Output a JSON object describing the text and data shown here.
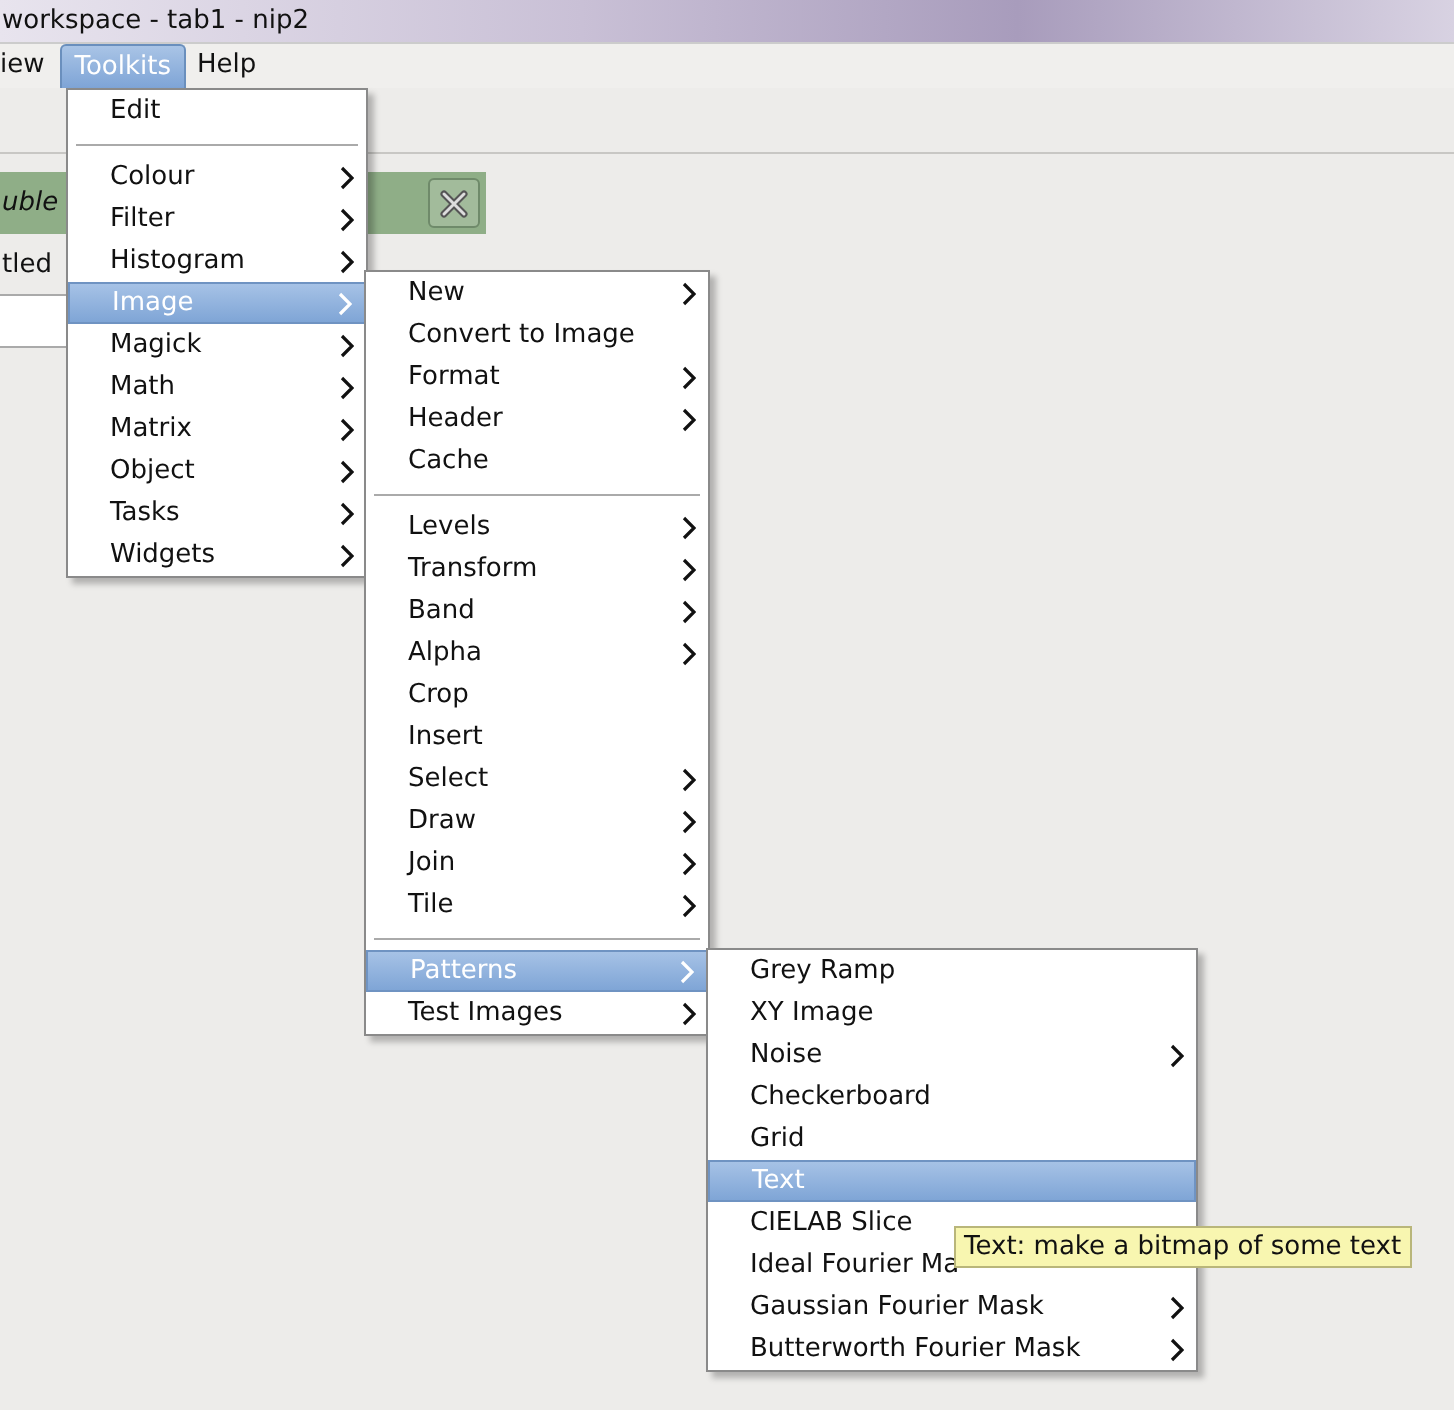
{
  "window": {
    "title": "workspace - tab1 - nip2"
  },
  "menubar": [
    {
      "label": "iew",
      "selected": false
    },
    {
      "label": "Toolkits",
      "selected": true
    },
    {
      "label": "Help",
      "selected": false
    }
  ],
  "workspace": {
    "panel_title": "uble",
    "row_label": "tled"
  },
  "menus": [
    {
      "items": [
        {
          "kind": "item",
          "label": "Edit",
          "submenu": false,
          "selected": false
        },
        {
          "kind": "separator"
        },
        {
          "kind": "item",
          "label": "Colour",
          "submenu": true,
          "selected": false
        },
        {
          "kind": "item",
          "label": "Filter",
          "submenu": true,
          "selected": false
        },
        {
          "kind": "item",
          "label": "Histogram",
          "submenu": true,
          "selected": false
        },
        {
          "kind": "item",
          "label": "Image",
          "submenu": true,
          "selected": true
        },
        {
          "kind": "item",
          "label": "Magick",
          "submenu": true,
          "selected": false
        },
        {
          "kind": "item",
          "label": "Math",
          "submenu": true,
          "selected": false
        },
        {
          "kind": "item",
          "label": "Matrix",
          "submenu": true,
          "selected": false
        },
        {
          "kind": "item",
          "label": "Object",
          "submenu": true,
          "selected": false
        },
        {
          "kind": "item",
          "label": "Tasks",
          "submenu": true,
          "selected": false
        },
        {
          "kind": "item",
          "label": "Widgets",
          "submenu": true,
          "selected": false
        }
      ]
    },
    {
      "items": [
        {
          "kind": "item",
          "label": "New",
          "submenu": true,
          "selected": false
        },
        {
          "kind": "item",
          "label": "Convert to Image",
          "submenu": false,
          "selected": false
        },
        {
          "kind": "item",
          "label": "Format",
          "submenu": true,
          "selected": false
        },
        {
          "kind": "item",
          "label": "Header",
          "submenu": true,
          "selected": false
        },
        {
          "kind": "item",
          "label": "Cache",
          "submenu": false,
          "selected": false
        },
        {
          "kind": "separator"
        },
        {
          "kind": "item",
          "label": "Levels",
          "submenu": true,
          "selected": false
        },
        {
          "kind": "item",
          "label": "Transform",
          "submenu": true,
          "selected": false
        },
        {
          "kind": "item",
          "label": "Band",
          "submenu": true,
          "selected": false
        },
        {
          "kind": "item",
          "label": "Alpha",
          "submenu": true,
          "selected": false
        },
        {
          "kind": "item",
          "label": "Crop",
          "submenu": false,
          "selected": false
        },
        {
          "kind": "item",
          "label": "Insert",
          "submenu": false,
          "selected": false
        },
        {
          "kind": "item",
          "label": "Select",
          "submenu": true,
          "selected": false
        },
        {
          "kind": "item",
          "label": "Draw",
          "submenu": true,
          "selected": false
        },
        {
          "kind": "item",
          "label": "Join",
          "submenu": true,
          "selected": false
        },
        {
          "kind": "item",
          "label": "Tile",
          "submenu": true,
          "selected": false
        },
        {
          "kind": "separator"
        },
        {
          "kind": "item",
          "label": "Patterns",
          "submenu": true,
          "selected": true
        },
        {
          "kind": "item",
          "label": "Test Images",
          "submenu": true,
          "selected": false
        }
      ]
    },
    {
      "items": [
        {
          "kind": "item",
          "label": "Grey Ramp",
          "submenu": false,
          "selected": false
        },
        {
          "kind": "item",
          "label": "XY Image",
          "submenu": false,
          "selected": false
        },
        {
          "kind": "item",
          "label": "Noise",
          "submenu": true,
          "selected": false
        },
        {
          "kind": "item",
          "label": "Checkerboard",
          "submenu": false,
          "selected": false
        },
        {
          "kind": "item",
          "label": "Grid",
          "submenu": false,
          "selected": false
        },
        {
          "kind": "item",
          "label": "Text",
          "submenu": false,
          "selected": true
        },
        {
          "kind": "item",
          "label": "CIELAB Slice",
          "submenu": false,
          "selected": false
        },
        {
          "kind": "item",
          "label": "Ideal Fourier Ma",
          "submenu": false,
          "selected": false
        },
        {
          "kind": "item",
          "label": "Gaussian Fourier Mask",
          "submenu": true,
          "selected": false
        },
        {
          "kind": "item",
          "label": "Butterworth Fourier Mask",
          "submenu": true,
          "selected": false
        }
      ]
    }
  ],
  "tooltip": "Text: make a bitmap of some text"
}
